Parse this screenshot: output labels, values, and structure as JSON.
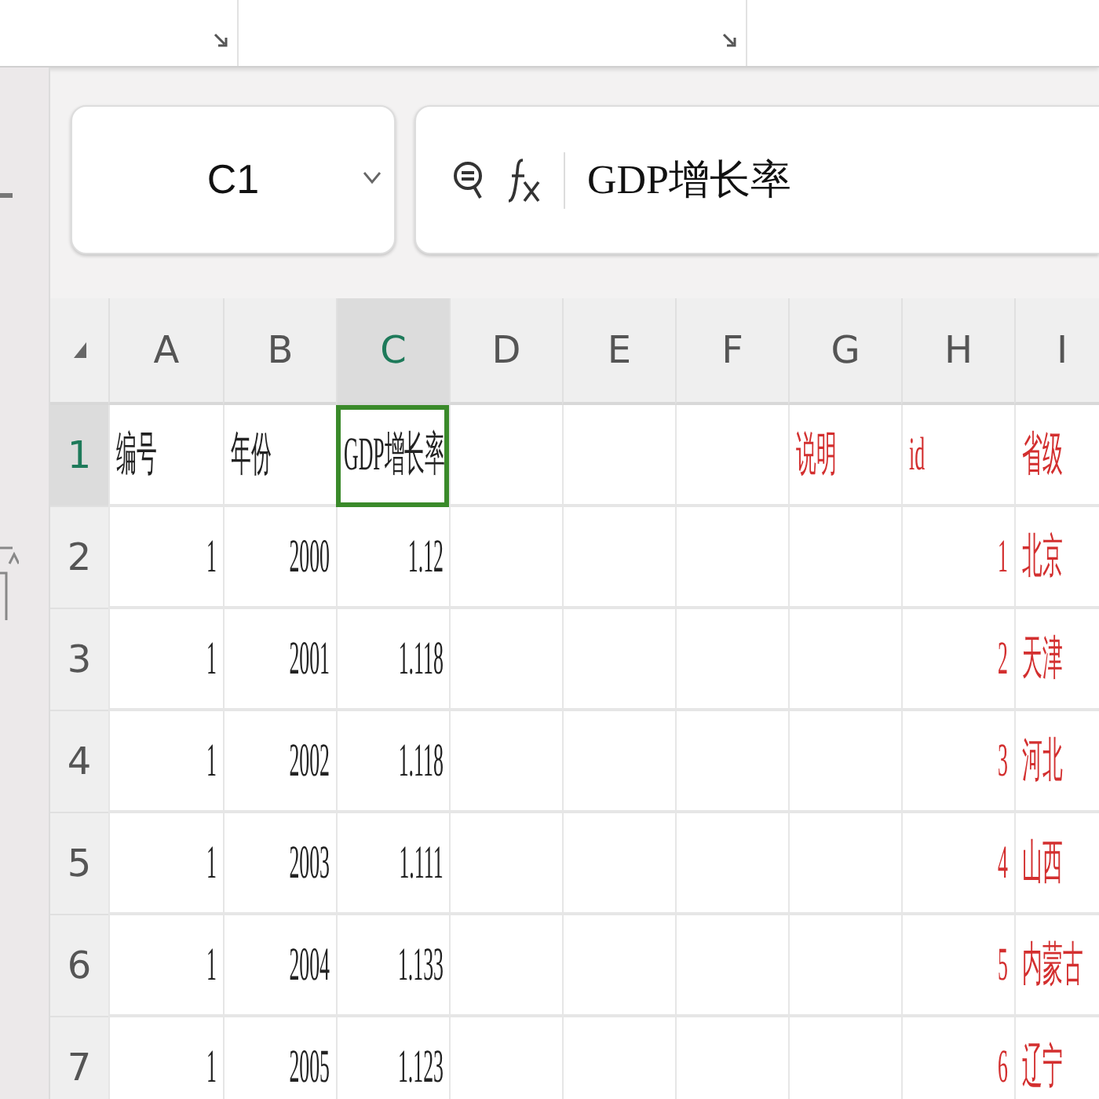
{
  "name_box": {
    "value": "C1"
  },
  "formula_bar": {
    "value": "GDP增长率"
  },
  "columns": [
    {
      "label": "A",
      "selected": false
    },
    {
      "label": "B",
      "selected": false
    },
    {
      "label": "C",
      "selected": true
    },
    {
      "label": "D",
      "selected": false
    },
    {
      "label": "E",
      "selected": false
    },
    {
      "label": "F",
      "selected": false
    },
    {
      "label": "G",
      "selected": false
    },
    {
      "label": "H",
      "selected": false
    },
    {
      "label": "I",
      "selected": false
    }
  ],
  "rows": [
    {
      "number": "1",
      "selected": true,
      "cells": [
        {
          "text": "编号",
          "kind": "text",
          "selected": false,
          "color": "#222222"
        },
        {
          "text": "年份",
          "kind": "text",
          "selected": false,
          "color": "#222222"
        },
        {
          "text": "GDP增长率",
          "kind": "text",
          "selected": true,
          "color": "#222222"
        },
        null,
        null,
        null,
        {
          "text": "说明",
          "kind": "text",
          "selected": false,
          "color": "#d32f2f"
        },
        {
          "text": "id",
          "kind": "text",
          "selected": false,
          "color": "#d32f2f"
        },
        {
          "text": "省级",
          "kind": "text",
          "selected": false,
          "color": "#d32f2f"
        }
      ]
    },
    {
      "number": "2",
      "selected": false,
      "cells": [
        {
          "text": "1",
          "kind": "number",
          "selected": false,
          "color": "#222222"
        },
        {
          "text": "2000",
          "kind": "number",
          "selected": false,
          "color": "#222222"
        },
        {
          "text": "1.12",
          "kind": "number",
          "selected": false,
          "color": "#222222"
        },
        null,
        null,
        null,
        null,
        {
          "text": "1",
          "kind": "number",
          "selected": false,
          "color": "#d32f2f"
        },
        {
          "text": "北京",
          "kind": "text",
          "selected": false,
          "color": "#d32f2f"
        }
      ]
    },
    {
      "number": "3",
      "selected": false,
      "cells": [
        {
          "text": "1",
          "kind": "number",
          "selected": false,
          "color": "#222222"
        },
        {
          "text": "2001",
          "kind": "number",
          "selected": false,
          "color": "#222222"
        },
        {
          "text": "1.118",
          "kind": "number",
          "selected": false,
          "color": "#222222"
        },
        null,
        null,
        null,
        null,
        {
          "text": "2",
          "kind": "number",
          "selected": false,
          "color": "#d32f2f"
        },
        {
          "text": "天津",
          "kind": "text",
          "selected": false,
          "color": "#d32f2f"
        }
      ]
    },
    {
      "number": "4",
      "selected": false,
      "cells": [
        {
          "text": "1",
          "kind": "number",
          "selected": false,
          "color": "#222222"
        },
        {
          "text": "2002",
          "kind": "number",
          "selected": false,
          "color": "#222222"
        },
        {
          "text": "1.118",
          "kind": "number",
          "selected": false,
          "color": "#222222"
        },
        null,
        null,
        null,
        null,
        {
          "text": "3",
          "kind": "number",
          "selected": false,
          "color": "#d32f2f"
        },
        {
          "text": "河北",
          "kind": "text",
          "selected": false,
          "color": "#d32f2f"
        }
      ]
    },
    {
      "number": "5",
      "selected": false,
      "cells": [
        {
          "text": "1",
          "kind": "number",
          "selected": false,
          "color": "#222222"
        },
        {
          "text": "2003",
          "kind": "number",
          "selected": false,
          "color": "#222222"
        },
        {
          "text": "1.111",
          "kind": "number",
          "selected": false,
          "color": "#222222"
        },
        null,
        null,
        null,
        null,
        {
          "text": "4",
          "kind": "number",
          "selected": false,
          "color": "#d32f2f"
        },
        {
          "text": "山西",
          "kind": "text",
          "selected": false,
          "color": "#d32f2f"
        }
      ]
    },
    {
      "number": "6",
      "selected": false,
      "cells": [
        {
          "text": "1",
          "kind": "number",
          "selected": false,
          "color": "#222222"
        },
        {
          "text": "2004",
          "kind": "number",
          "selected": false,
          "color": "#222222"
        },
        {
          "text": "1.133",
          "kind": "number",
          "selected": false,
          "color": "#222222"
        },
        null,
        null,
        null,
        null,
        {
          "text": "5",
          "kind": "number",
          "selected": false,
          "color": "#d32f2f"
        },
        {
          "text": "内蒙古",
          "kind": "text",
          "selected": false,
          "color": "#d32f2f"
        }
      ]
    },
    {
      "number": "7",
      "selected": false,
      "cells": [
        {
          "text": "1",
          "kind": "number",
          "selected": false,
          "color": "#222222"
        },
        {
          "text": "2005",
          "kind": "number",
          "selected": false,
          "color": "#222222"
        },
        {
          "text": "1.123",
          "kind": "number",
          "selected": false,
          "color": "#222222"
        },
        null,
        null,
        null,
        null,
        {
          "text": "6",
          "kind": "number",
          "selected": false,
          "color": "#d32f2f"
        },
        {
          "text": "辽宁",
          "kind": "text",
          "selected": false,
          "color": "#d32f2f"
        }
      ]
    }
  ]
}
